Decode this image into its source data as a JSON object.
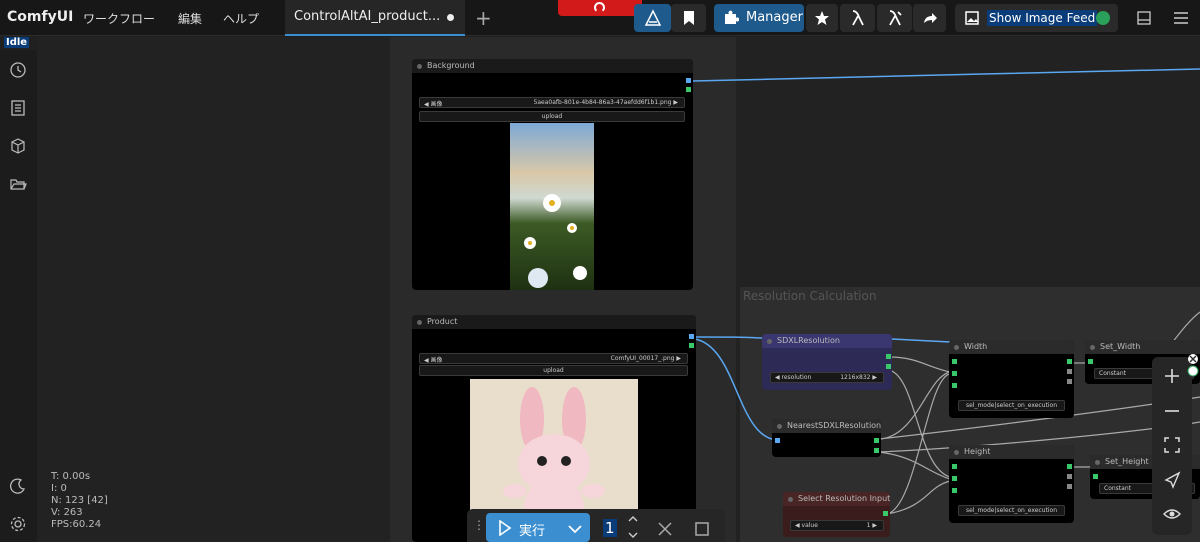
{
  "app": {
    "brand": "ComfyUI",
    "status": "Idle"
  },
  "menu": {
    "workflow": "ワークフロー",
    "edit": "編集",
    "help": "ヘルプ"
  },
  "tab": {
    "label": "ControlAltAI_product..."
  },
  "toolbar": {
    "manager_label": "Manager",
    "image_feed_label": "Show Image Feed"
  },
  "stats": {
    "t": "T: 0.00s",
    "i": "I: 0",
    "n": "N: 123 [42]",
    "v": "V: 263",
    "fps": "FPS:60.24"
  },
  "nodes": {
    "background": {
      "title": "Background",
      "image_label": "画像",
      "image_value": "5aea0afb-801e-4b84-86a3-47aefdd6f1b1.png",
      "upload": "upload"
    },
    "product": {
      "title": "Product",
      "image_label": "画像",
      "image_value": "ComfyUI_00017_.png",
      "upload": "upload"
    },
    "group_title": "Resolution Calculation",
    "sdxl": {
      "title": "SDXLResolution",
      "widget_label": "resolution",
      "widget_value": "1216x832"
    },
    "nearest": {
      "title": "NearestSDXLResolution"
    },
    "select": {
      "title": "Select Resolution Input",
      "widget_label": "value",
      "widget_value": "1"
    },
    "width": {
      "title": "Width",
      "widget": "sel_mode|select_on_execution"
    },
    "height": {
      "title": "Height",
      "widget": "sel_mode|select_on_execution"
    },
    "set_width": {
      "title": "Set_Width",
      "widget": "Constant"
    },
    "set_height": {
      "title": "Set_Height",
      "widget": "Constant"
    }
  },
  "runbar": {
    "run_label": "実行",
    "count": "1"
  },
  "colors": {
    "accent": "#3b8fd1",
    "link": "#5aa7f2",
    "port_green": "#39c96a",
    "stop_red": "#d21a1a"
  }
}
